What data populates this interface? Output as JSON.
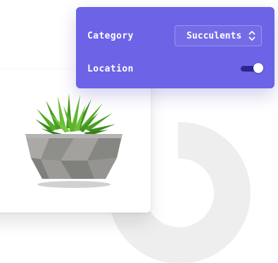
{
  "settings": {
    "category": {
      "label": "Category",
      "value": "Succulents"
    },
    "location": {
      "label": "Location",
      "enabled": true
    }
  },
  "product": {
    "image": "potted-succulent-plant"
  },
  "colors": {
    "panel": "#6c63e6",
    "toggle_track": "#2e2690",
    "ring": "#eeeeee",
    "background": "#ffffff"
  }
}
